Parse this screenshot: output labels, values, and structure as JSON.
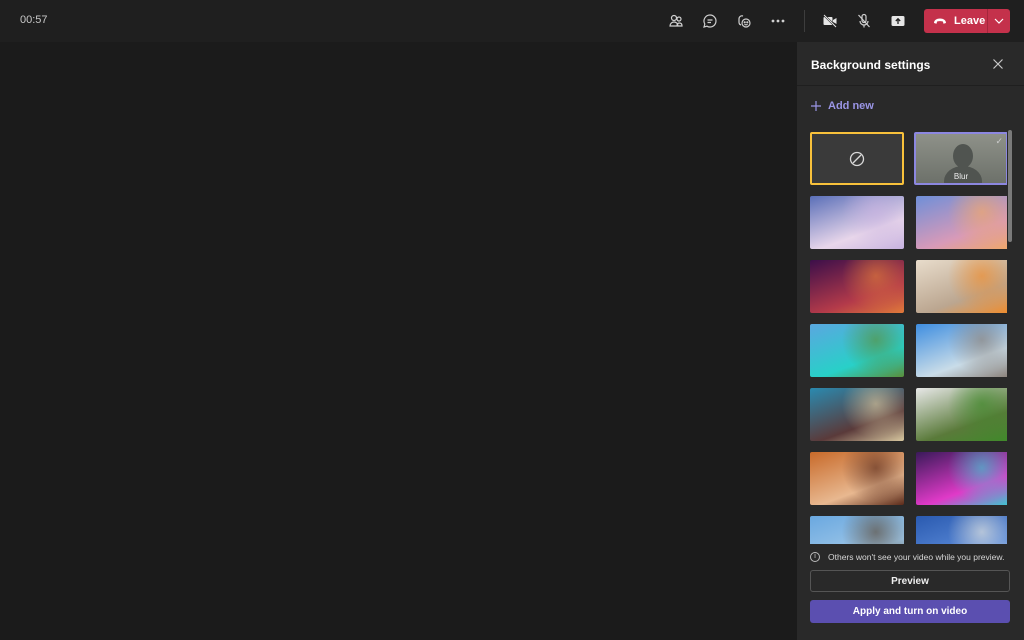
{
  "header": {
    "timer": "00:57",
    "toolbar": [
      {
        "name": "people-icon",
        "label": "People"
      },
      {
        "name": "chat-icon",
        "label": "Chat"
      },
      {
        "name": "reactions-icon",
        "label": "React"
      },
      {
        "name": "more-icon",
        "label": "More actions"
      },
      {
        "name": "camera-off-icon",
        "label": "Camera"
      },
      {
        "name": "mic-off-icon",
        "label": "Mic"
      },
      {
        "name": "share-icon",
        "label": "Share"
      }
    ],
    "leave_label": "Leave",
    "leave_color": "#c4314b"
  },
  "panel": {
    "title": "Background settings",
    "add_new_label": "Add new",
    "none_option": "No background",
    "blur_label": "Blur",
    "backgrounds": [
      {
        "name": "ice-cave",
        "colors": [
          "#5a6fb8",
          "#e8d6ea",
          "#c7b2e0"
        ]
      },
      {
        "name": "cartoon-arch",
        "colors": [
          "#6f8fd8",
          "#d89ab8",
          "#f0a868"
        ]
      },
      {
        "name": "purple-bokeh",
        "colors": [
          "#3c0f4a",
          "#b33a4a",
          "#e07a3a"
        ]
      },
      {
        "name": "cozy-bed",
        "colors": [
          "#e8dccb",
          "#bba690",
          "#f08c2c"
        ]
      },
      {
        "name": "tropical-beach",
        "colors": [
          "#5aa7e0",
          "#28d0c8",
          "#5a8f3a"
        ]
      },
      {
        "name": "beach-lifeguard",
        "colors": [
          "#3f8ee0",
          "#c9dce8",
          "#8a8078"
        ]
      },
      {
        "name": "fantasy-landscape",
        "colors": [
          "#2a8ab0",
          "#5a3a3a",
          "#d8c8a0"
        ]
      },
      {
        "name": "mountain-valley",
        "colors": [
          "#e8e8e8",
          "#5a7a3a",
          "#3f8a2a"
        ]
      },
      {
        "name": "canyon",
        "colors": [
          "#c86a2a",
          "#e8b890",
          "#5a2a1a"
        ]
      },
      {
        "name": "nebula",
        "colors": [
          "#3a1a5a",
          "#e03ac8",
          "#3ac8d0"
        ]
      },
      {
        "name": "desert-structure",
        "colors": [
          "#6aa8e0",
          "#a0c8e8",
          "#5a4a3a"
        ]
      },
      {
        "name": "sky-clouds",
        "colors": [
          "#2a5ab0",
          "#5a8ad8",
          "#e8e8e0"
        ]
      }
    ],
    "info_text": "Others won't see your video while you preview.",
    "preview_label": "Preview",
    "apply_label": "Apply and turn on video",
    "apply_color": "#5b4fb0"
  }
}
